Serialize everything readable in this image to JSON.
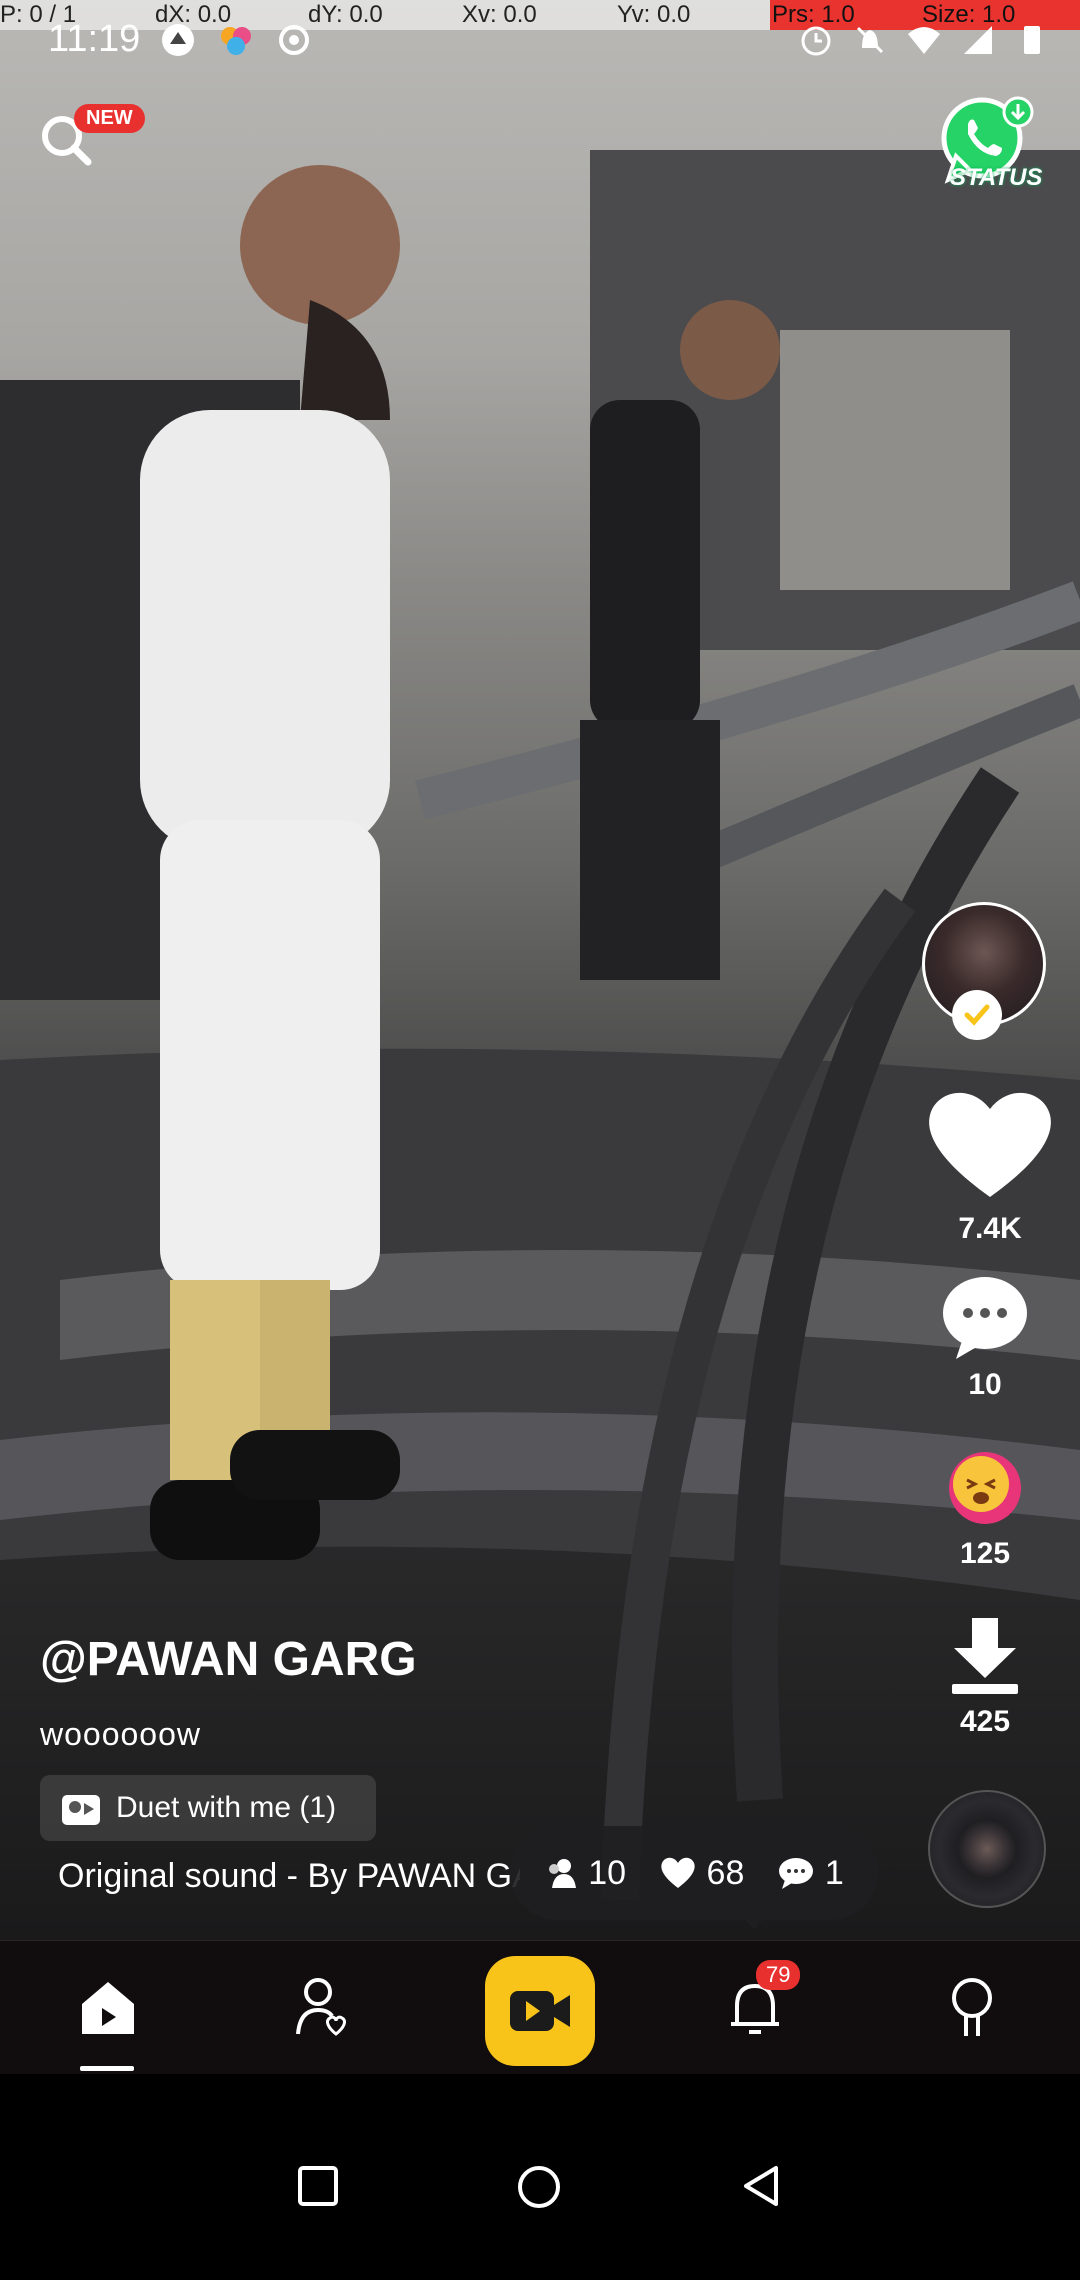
{
  "debug": {
    "pointer": "P: 0 / 1",
    "dx": "dX: 0.0",
    "dy": "dY: 0.0",
    "xv": "Xv: 0.0",
    "yv": "Yv: 0.0",
    "prs": "Prs: 1.0",
    "size": "Size: 1.0"
  },
  "status_bar": {
    "time": "11:19"
  },
  "top": {
    "new_badge": "NEW",
    "status_label": "STATUS"
  },
  "actions": {
    "likes": "7.4K",
    "comments": "10",
    "reactions": "125",
    "downloads": "425"
  },
  "post": {
    "username": "@PAWAN GARG",
    "caption": "woooooow",
    "duet_label": "Duet with me (1)",
    "sound": "Original sound - By PAWAN GARG"
  },
  "stats": {
    "viewers": "10",
    "hearts": "68",
    "messages": "1"
  },
  "nav": {
    "notification_count": "79"
  },
  "colors": {
    "accent_yellow": "#f8c41a",
    "badge_red": "#e8312f",
    "whatsapp_green": "#25d366"
  }
}
